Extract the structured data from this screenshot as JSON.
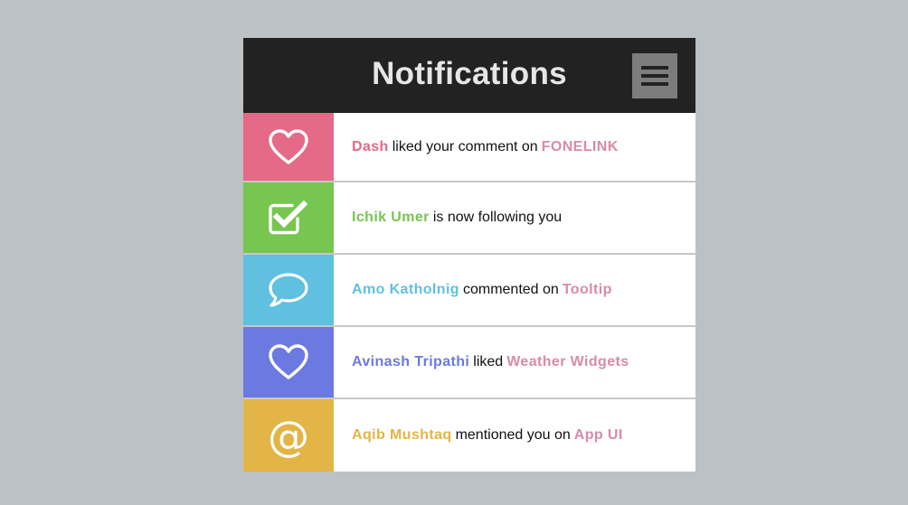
{
  "header": {
    "title": "Notifications",
    "menu_icon": "hamburger-menu-icon"
  },
  "colors": {
    "background": "#bcc1c5",
    "header": "#222222",
    "target_link": "#d98aa8"
  },
  "notifications": [
    {
      "icon": "heart-icon",
      "icon_bg": "#e56a87",
      "actor": "Dash",
      "actor_color": "#e56a87",
      "action": "liked your comment on",
      "target": "FONELINK"
    },
    {
      "icon": "checkbox-icon",
      "icon_bg": "#77c64f",
      "actor": "Ichik Umer",
      "actor_color": "#77c64f",
      "action": "is now following you",
      "target": ""
    },
    {
      "icon": "speech-bubble-icon",
      "icon_bg": "#5fc0e0",
      "actor": "Amo Katholnig",
      "actor_color": "#5fc0e0",
      "action": "commented on",
      "target": "Tooltip"
    },
    {
      "icon": "heart-icon",
      "icon_bg": "#6c79e0",
      "actor": "Avinash Tripathi",
      "actor_color": "#6c79e0",
      "action": "liked",
      "target": "Weather Widgets"
    },
    {
      "icon": "at-sign-icon",
      "icon_bg": "#e3b546",
      "icon_text": "@",
      "actor": "Aqib Mushtaq",
      "actor_color": "#e3b546",
      "action": "mentioned you on",
      "target": "App UI"
    }
  ]
}
